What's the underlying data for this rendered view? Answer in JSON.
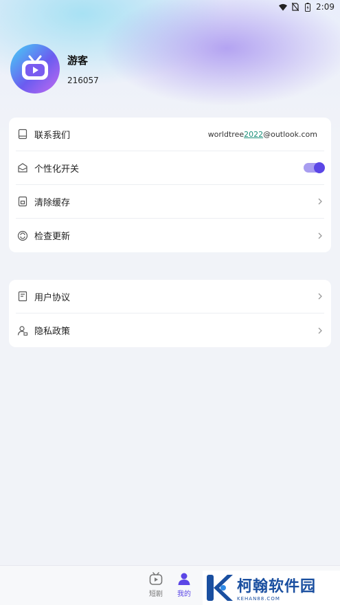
{
  "status_bar": {
    "time": "2:09"
  },
  "profile": {
    "name": "游客",
    "id": "216057"
  },
  "card1": {
    "contact": {
      "label": "联系我们",
      "value_prefix": "worldtree",
      "value_highlight": "2022",
      "value_suffix": "@outlook.com"
    },
    "personalize": {
      "label": "个性化开关",
      "enabled": true
    },
    "clear_cache": {
      "label": "清除缓存"
    },
    "check_update": {
      "label": "检查更新"
    }
  },
  "card2": {
    "user_agreement": {
      "label": "用户协议"
    },
    "privacy_policy": {
      "label": "隐私政策"
    }
  },
  "nav": {
    "tabs": [
      {
        "label": "短剧",
        "icon": "tv-icon",
        "active": false
      },
      {
        "label": "我的",
        "icon": "person-icon",
        "active": true
      }
    ]
  },
  "watermark": {
    "title": "柯翰软件园",
    "sub": "KEHAN88.COM"
  },
  "colors": {
    "accent": "#5b46e6",
    "toggle_track": "#a89df0",
    "link_highlight": "#1a8f7a"
  }
}
